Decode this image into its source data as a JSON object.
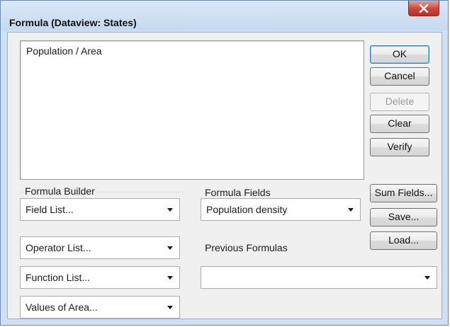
{
  "window": {
    "title": "Formula (Dataview: States)"
  },
  "formula": {
    "text": "Population / Area"
  },
  "buttons": {
    "ok": "OK",
    "cancel": "Cancel",
    "delete": "Delete",
    "clear": "Clear",
    "verify": "Verify",
    "sum_fields": "Sum Fields...",
    "save": "Save...",
    "load": "Load..."
  },
  "formula_builder": {
    "label": "Formula Builder",
    "field_list": "Field List...",
    "operator_list": "Operator List...",
    "function_list": "Function List...",
    "values_of": "Values of Area..."
  },
  "formula_fields": {
    "label": "Formula Fields",
    "selected": "Population density"
  },
  "previous_formulas": {
    "label": "Previous Formulas",
    "selected": ""
  }
}
